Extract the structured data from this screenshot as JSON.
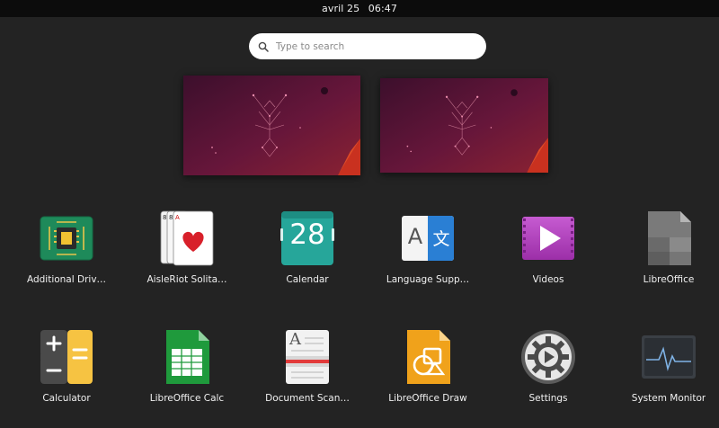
{
  "topbar": {
    "date": "avril 25",
    "time": "06:47"
  },
  "search": {
    "placeholder": "Type to search"
  },
  "workspaces": [
    {
      "label": ""
    },
    {
      "label": ""
    }
  ],
  "apps": [
    {
      "label": "Additional Driv…",
      "icon": "chip-icon"
    },
    {
      "label": "AisleRiot Solita…",
      "icon": "playing-cards-icon"
    },
    {
      "label": "Calendar",
      "icon": "calendar-icon",
      "day": "28"
    },
    {
      "label": "Language Supp…",
      "icon": "language-icon",
      "glyph_a": "A",
      "glyph_b": "文"
    },
    {
      "label": "Videos",
      "icon": "video-play-icon"
    },
    {
      "label": "LibreOffice",
      "icon": "libreoffice-icon"
    },
    {
      "label": "Calculator",
      "icon": "calculator-icon"
    },
    {
      "label": "LibreOffice Calc",
      "icon": "spreadsheet-icon"
    },
    {
      "label": "Document Scan…",
      "icon": "scanner-icon",
      "glyph": "A"
    },
    {
      "label": "LibreOffice Draw",
      "icon": "draw-icon"
    },
    {
      "label": "Settings",
      "icon": "gear-icon"
    },
    {
      "label": "System Monitor",
      "icon": "system-monitor-icon"
    }
  ],
  "colors": {
    "background": "#232323",
    "topbar": "#0c0c0c",
    "wallpaper": "#5a1433",
    "accent_orange": "#e95420"
  }
}
